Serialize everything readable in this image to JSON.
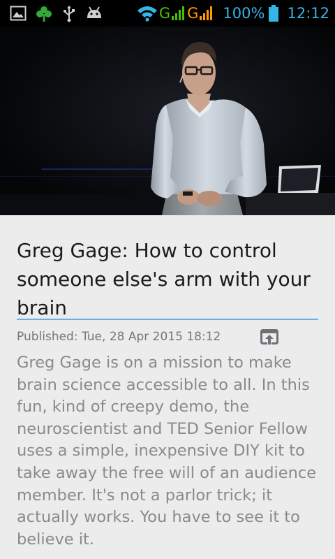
{
  "status_bar": {
    "icons": [
      "gallery-icon",
      "clover-icon",
      "usb-icon",
      "android-debug-icon",
      "wifi-icon",
      "signal-icon",
      "signal-icon-2",
      "battery-icon"
    ],
    "network_1": "G",
    "network_2": "G",
    "battery": "100%",
    "time": "12:12",
    "colors": {
      "accent": "#35b5e5",
      "net1": "#43c000",
      "net2": "#ff9b00"
    }
  },
  "video": {
    "icon": "video-thumbnail"
  },
  "article": {
    "title": "Greg Gage: How to control someone else's arm with your brain",
    "published": "Published: Tue, 28 Apr 2015 18:12",
    "share_icon": "open-external-icon",
    "description": "Greg Gage is on a mission to make brain science accessible to all. In this fun, kind of creepy demo, the neuroscientist and TED Senior Fellow uses a simple, inexpensive DIY kit to take away the free will of an audience member. It's not a parlor trick; it actually works. You have to see it to believe it.",
    "colors": {
      "divider": "#6ab0e3",
      "title": "#1a1a1a",
      "body": "#8a8a8a"
    }
  }
}
